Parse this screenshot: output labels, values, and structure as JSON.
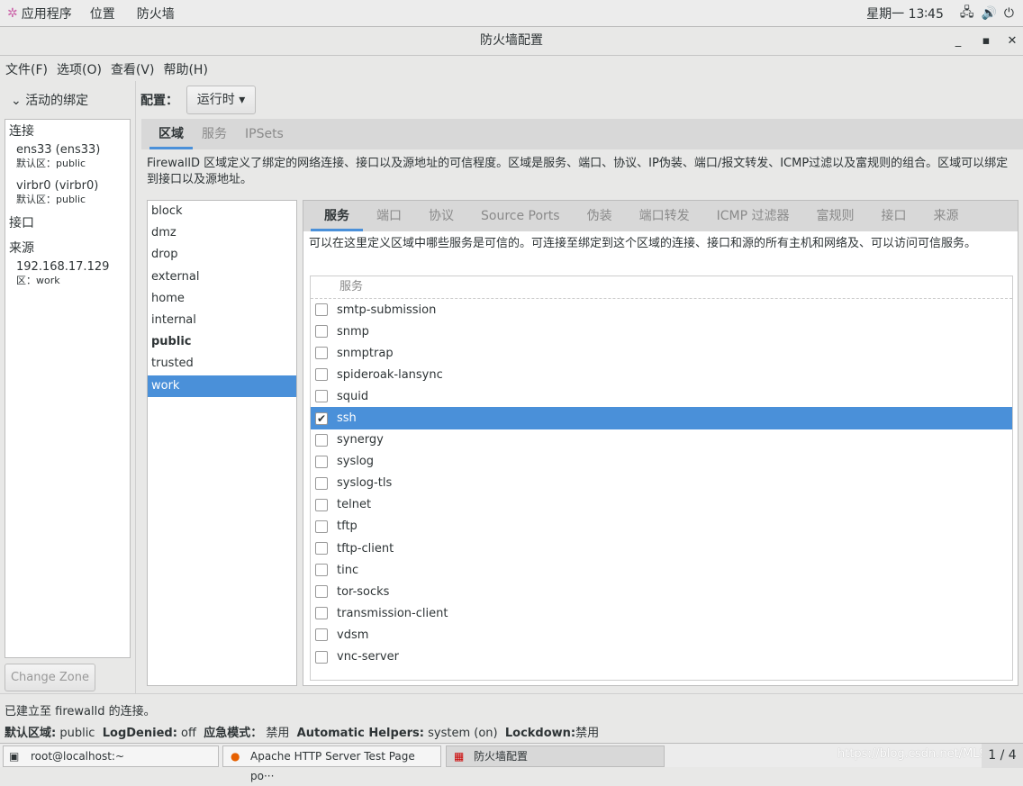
{
  "topbar": {
    "apps": "应用程序",
    "places": "位置",
    "app": "防火墙",
    "clock": "星期一 13∶45"
  },
  "window": {
    "title": "防火墙配置",
    "min": "_",
    "max": "▪",
    "close": "✕"
  },
  "menu": [
    "文件(F)",
    "选项(O)",
    "查看(V)",
    "帮助(H)"
  ],
  "left": {
    "header": "活动的绑定",
    "connections": "连接",
    "conns": [
      {
        "name": "ens33 (ens33)",
        "zone": "默认区：public"
      },
      {
        "name": "virbr0 (virbr0)",
        "zone": "默认区：public"
      }
    ],
    "interfaces": "接口",
    "sources": "来源",
    "src": [
      {
        "name": "192.168.17.129",
        "zone": "区：work"
      }
    ],
    "change_zone": "Change Zone"
  },
  "config": {
    "label": "配置：",
    "value": "运行时"
  },
  "tabs": [
    "区域",
    "服务",
    "IPSets"
  ],
  "zone_desc": "FirewallD 区域定义了绑定的网络连接、接口以及源地址的可信程度。区域是服务、端口、协议、IP伪装、端口/报文转发、ICMP过滤以及富规则的组合。区域可以绑定到接口以及源地址。",
  "zones": [
    "block",
    "dmz",
    "drop",
    "external",
    "home",
    "internal",
    "public",
    "trusted",
    "work"
  ],
  "zone_tabs": [
    "服务",
    "端口",
    "协议",
    "Source Ports",
    "伪装",
    "端口转发",
    "ICMP 过滤器",
    "富规则",
    "接口",
    "来源"
  ],
  "svc_desc": "可以在这里定义区域中哪些服务是可信的。可连接至绑定到这个区域的连接、接口和源的所有主机和网络及、可以访问可信服务。",
  "svc_header": "服务",
  "services": [
    {
      "n": "smtp-submission",
      "c": false
    },
    {
      "n": "snmp",
      "c": false
    },
    {
      "n": "snmptrap",
      "c": false
    },
    {
      "n": "spideroak-lansync",
      "c": false
    },
    {
      "n": "squid",
      "c": false
    },
    {
      "n": "ssh",
      "c": true
    },
    {
      "n": "synergy",
      "c": false
    },
    {
      "n": "syslog",
      "c": false
    },
    {
      "n": "syslog-tls",
      "c": false
    },
    {
      "n": "telnet",
      "c": false
    },
    {
      "n": "tftp",
      "c": false
    },
    {
      "n": "tftp-client",
      "c": false
    },
    {
      "n": "tinc",
      "c": false
    },
    {
      "n": "tor-socks",
      "c": false
    },
    {
      "n": "transmission-client",
      "c": false
    },
    {
      "n": "vdsm",
      "c": false
    },
    {
      "n": "vnc-server",
      "c": false
    }
  ],
  "status": {
    "msg": "已建立至  firewalld 的连接。",
    "k1": "默认区域:",
    "v1": "public",
    "k2": "LogDenied:",
    "v2": "off",
    "k3": "应急模式：",
    "v3": "禁用",
    "k4": "Automatic Helpers:",
    "v4": "system (on)",
    "k5": "Lockdown:",
    "v5": "禁用"
  },
  "taskbar": {
    "t1": "root@localhost:~",
    "t2": "Apache HTTP Server Test Page po···",
    "t3": "防火墙配置",
    "watermark": "https://blog.csdn.net/ML908",
    "pager": "1 / 4"
  },
  "colors": {
    "accent": "#4a90d9"
  }
}
